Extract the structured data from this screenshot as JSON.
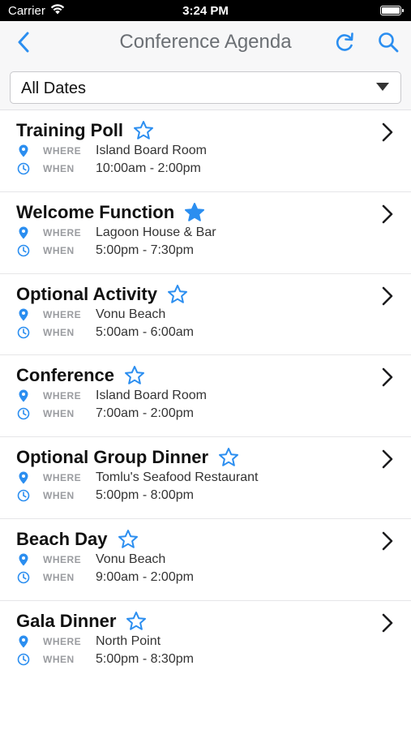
{
  "status_bar": {
    "carrier": "Carrier",
    "time": "3:24 PM"
  },
  "nav": {
    "title": "Conference Agenda"
  },
  "filter": {
    "selected": "All Dates"
  },
  "labels": {
    "where": "WHERE",
    "when": "WHEN"
  },
  "colors": {
    "accent": "#2b8ef0",
    "title_gray": "#6b6f74"
  },
  "events": [
    {
      "title": "Training Poll",
      "starred": false,
      "where": "Island Board Room",
      "when": "10:00am - 2:00pm"
    },
    {
      "title": "Welcome Function",
      "starred": true,
      "where": "Lagoon House & Bar",
      "when": "5:00pm - 7:30pm"
    },
    {
      "title": "Optional Activity",
      "starred": false,
      "where": "Vonu Beach",
      "when": "5:00am - 6:00am"
    },
    {
      "title": "Conference",
      "starred": false,
      "where": "Island Board Room",
      "when": "7:00am - 2:00pm"
    },
    {
      "title": "Optional Group Dinner",
      "starred": false,
      "where": "Tomlu's Seafood Restaurant",
      "when": "5:00pm - 8:00pm"
    },
    {
      "title": "Beach Day",
      "starred": false,
      "where": "Vonu Beach",
      "when": "9:00am - 2:00pm"
    },
    {
      "title": "Gala Dinner",
      "starred": false,
      "where": "North Point",
      "when": "5:00pm - 8:30pm"
    }
  ]
}
